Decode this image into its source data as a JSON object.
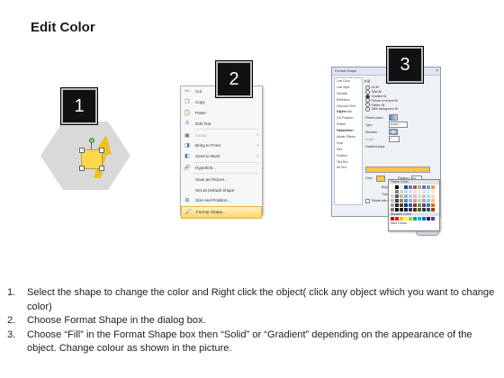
{
  "title": "Edit Color",
  "badges": [
    "1",
    "2",
    "3"
  ],
  "menu": {
    "items": [
      {
        "icon": "scissors-icon",
        "glyph": "✂",
        "label": "Cut",
        "dim": false
      },
      {
        "icon": "copy-icon",
        "glyph": "❐",
        "label": "Copy",
        "dim": false
      },
      {
        "icon": "paste-icon",
        "glyph": "📋",
        "label": "Paste",
        "dim": false
      },
      {
        "icon": "edit-text-icon",
        "glyph": "A",
        "label": "Edit Text",
        "dim": false
      },
      {
        "icon": "group-icon",
        "glyph": "▣",
        "label": "Group",
        "dim": true,
        "sub": "›"
      },
      {
        "icon": "bring-to-front-icon",
        "glyph": "◨",
        "label": "Bring to Front",
        "dim": false,
        "sub": "›"
      },
      {
        "icon": "send-to-back-icon",
        "glyph": "◧",
        "label": "Send to Back",
        "dim": false,
        "sub": "›"
      },
      {
        "icon": "hyperlink-icon",
        "glyph": "🔗",
        "label": "Hyperlink...",
        "dim": false
      },
      {
        "icon": "save-picture-icon",
        "glyph": " ",
        "label": "Save as Picture...",
        "dim": false
      },
      {
        "icon": "default-shape-icon",
        "glyph": " ",
        "label": "Set as Default Shape",
        "dim": false
      },
      {
        "icon": "size-position-icon",
        "glyph": "⊞",
        "label": "Size and Position...",
        "dim": false
      },
      {
        "icon": "format-shape-icon",
        "glyph": "🖌",
        "label": "Format Shape...",
        "dim": false,
        "highlight": true
      }
    ]
  },
  "dialog": {
    "title": "Format Shape",
    "close_glyph": "×",
    "nav": [
      "Fill",
      "Line Color",
      "Line Style",
      "Shadow",
      "Reflection",
      "Glow and Soft Edges",
      "3-D Format",
      "3-D Rotation",
      "Picture Corrections",
      "Picture Color",
      "Artistic Effects",
      "Crop",
      "Size",
      "Position",
      "Text Box",
      "Alt Text"
    ],
    "pane_heading": "Fill",
    "fill_options": [
      "No fill",
      "Solid fill",
      "Gradient fill",
      "Picture or texture fill",
      "Pattern fill",
      "Slide background fill"
    ],
    "selected_fill": 2,
    "fields": [
      "Preset colors:",
      "Type:",
      "Direction:",
      "Angle:",
      "Gradient stops"
    ],
    "type_value": "Radial",
    "angle_value": "0°",
    "color_label": "Color",
    "position_label": "Position:",
    "position_value": "0%",
    "brightness_label": "Brightness:",
    "transparency_label": "Transparency:",
    "rotate_label": "Rotate with shape",
    "close_label": "Close"
  },
  "palette": {
    "theme_heading": "Theme Colors",
    "standard_heading": "Standard Colors",
    "more_label": "More Colors...",
    "theme_colors": [
      "#ffffff",
      "#000000",
      "#eeece1",
      "#1f497d",
      "#4f81bd",
      "#c0504d",
      "#9bbb59",
      "#8064a2",
      "#4bacc6",
      "#f79646",
      "#f2f2f2",
      "#7f7f7f",
      "#ddd9c3",
      "#c6d9f0",
      "#dbe5f1",
      "#f2dcdb",
      "#ebf1dd",
      "#e5e0ec",
      "#dbeef3",
      "#fdeada",
      "#d8d8d8",
      "#595959",
      "#c4bd97",
      "#8db3e2",
      "#b8cce4",
      "#e5b9b7",
      "#d7e3bc",
      "#ccc1d9",
      "#b7dde8",
      "#fbd5b5",
      "#bfbfbf",
      "#3f3f3f",
      "#938953",
      "#548dd4",
      "#95b3d7",
      "#d99694",
      "#c3d69b",
      "#b2a2c7",
      "#92cddc",
      "#fac08f",
      "#a5a5a5",
      "#262626",
      "#494429",
      "#17365d",
      "#366092",
      "#953734",
      "#76923c",
      "#5f497a",
      "#31859b",
      "#e36c09",
      "#7f7f7f",
      "#0c0c0c",
      "#1d1b10",
      "#0f243e",
      "#244061",
      "#632423",
      "#4f6128",
      "#3f3151",
      "#205867",
      "#974806"
    ],
    "standard_colors": [
      "#c00000",
      "#ff0000",
      "#ffc000",
      "#ffff00",
      "#92d050",
      "#00b050",
      "#00b0f0",
      "#0070c0",
      "#002060",
      "#7030a0"
    ]
  },
  "instructions": [
    {
      "num": "1.",
      "text": "Select the shape to change the color and Right click the object( click any object which you want to change color)"
    },
    {
      "num": "2.",
      "text": "Choose Format Shape in the dialog box."
    },
    {
      "num": "3.",
      "text": "Choose “Fill” in the Format Shape box then “Solid” or “Gradient” depending on the appearance of the object. Change colour as shown in the picture."
    }
  ],
  "colors": {
    "badge_bg": "#111111",
    "highlight": "#ffd667",
    "shape_fill": "#ffd84d",
    "hexagon": "#d9d9d9"
  }
}
